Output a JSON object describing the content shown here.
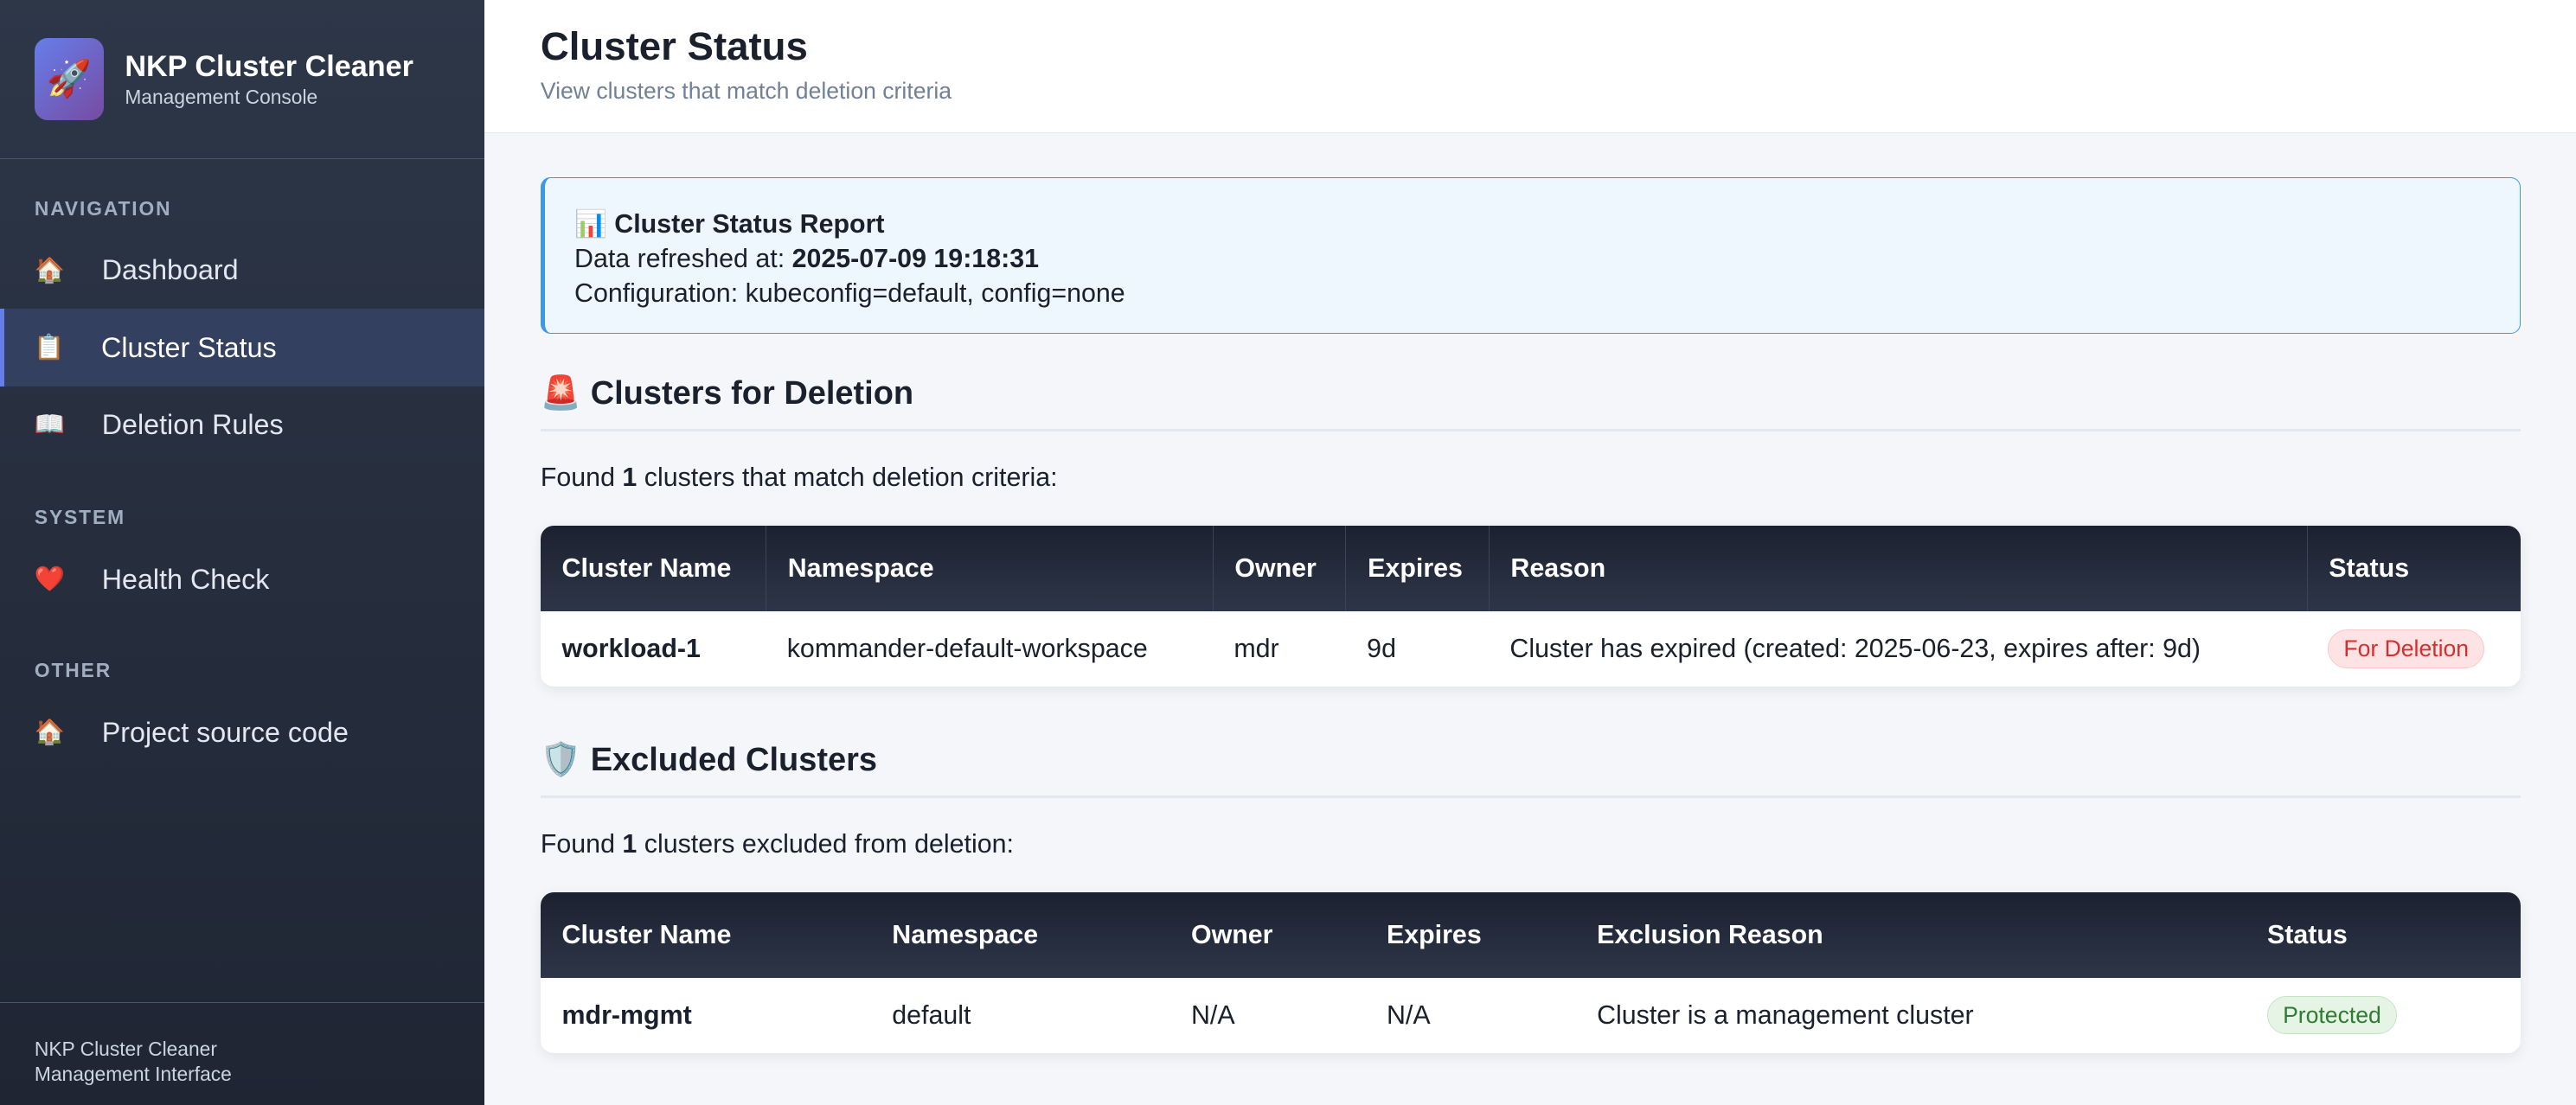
{
  "sidebar": {
    "title": "NKP Cluster Cleaner",
    "subtitle": "Management Console",
    "logo_icon": "🚀",
    "sections": [
      {
        "label": "NAVIGATION",
        "items": [
          {
            "icon": "🏠",
            "label": "Dashboard"
          },
          {
            "icon": "📋",
            "label": "Cluster Status",
            "active": true
          },
          {
            "icon": "📖",
            "label": "Deletion Rules"
          }
        ]
      },
      {
        "label": "SYSTEM",
        "items": [
          {
            "icon": "❤️",
            "label": "Health Check"
          }
        ]
      },
      {
        "label": "OTHER",
        "items": [
          {
            "icon": "🏠",
            "label": "Project source code"
          }
        ]
      }
    ],
    "footer_line1": "NKP Cluster Cleaner",
    "footer_line2": "Management Interface"
  },
  "header": {
    "title": "Cluster Status",
    "subtitle": "View clusters that match deletion criteria"
  },
  "report": {
    "icon": "📊",
    "title": "Cluster Status Report",
    "refreshed_label": "Data refreshed at: ",
    "refreshed_value": "2025-07-09 19:18:31",
    "configuration": "Configuration: kubeconfig=default, config=none"
  },
  "deletion": {
    "icon": "🚨",
    "heading": "Clusters for Deletion",
    "found_prefix": "Found ",
    "count": "1",
    "found_suffix": " clusters that match deletion criteria:",
    "columns": [
      "Cluster Name",
      "Namespace",
      "Owner",
      "Expires",
      "Reason",
      "Status"
    ],
    "rows": [
      {
        "name": "workload-1",
        "namespace": "kommander-default-workspace",
        "owner": "mdr",
        "expires": "9d",
        "reason": "Cluster has expired (created: 2025-06-23, expires after: 9d)",
        "status": "For Deletion"
      }
    ]
  },
  "excluded": {
    "icon": "🛡️",
    "heading": "Excluded Clusters",
    "found_prefix": "Found ",
    "count": "1",
    "found_suffix": " clusters excluded from deletion:",
    "columns": [
      "Cluster Name",
      "Namespace",
      "Owner",
      "Expires",
      "Exclusion Reason",
      "Status"
    ],
    "rows": [
      {
        "name": "mdr-mgmt",
        "namespace": "default",
        "owner": "N/A",
        "expires": "N/A",
        "reason": "Cluster is a management cluster",
        "status": "Protected"
      }
    ]
  },
  "colors": {
    "accent": "#667eea",
    "info_border": "#3b9ae8",
    "danger": "#d32f2f",
    "success": "#2e7d32"
  }
}
